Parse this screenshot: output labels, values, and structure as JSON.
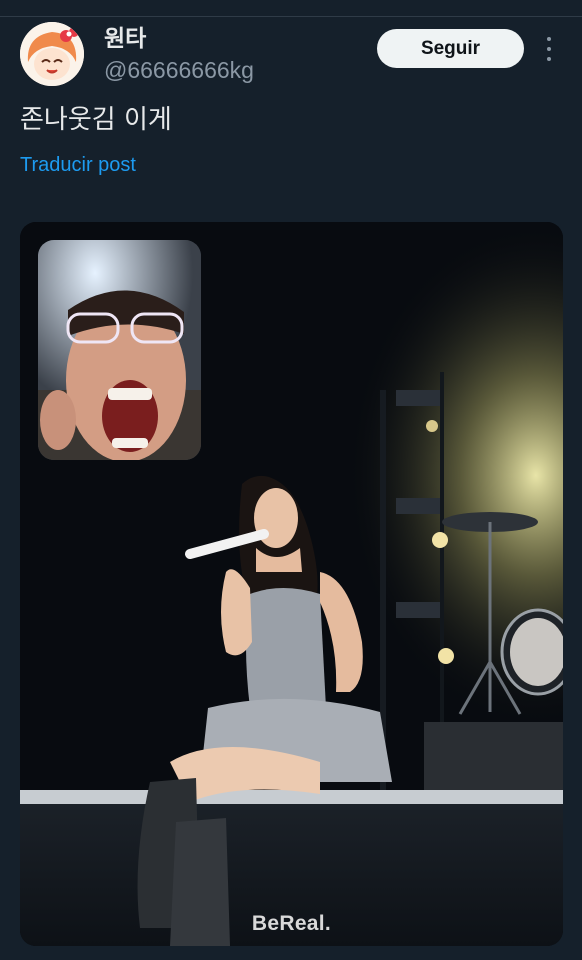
{
  "tweet": {
    "display_name": "원타",
    "handle": "@66666666kg",
    "follow_label": "Seguir",
    "text": "존나웃김 이게",
    "translate_label": "Traducir post"
  },
  "media": {
    "watermark": "BeReal."
  },
  "colors": {
    "background": "#15202b",
    "link": "#1d9bf0",
    "button_bg": "#eff3f4",
    "secondary_text": "#8b98a5"
  }
}
